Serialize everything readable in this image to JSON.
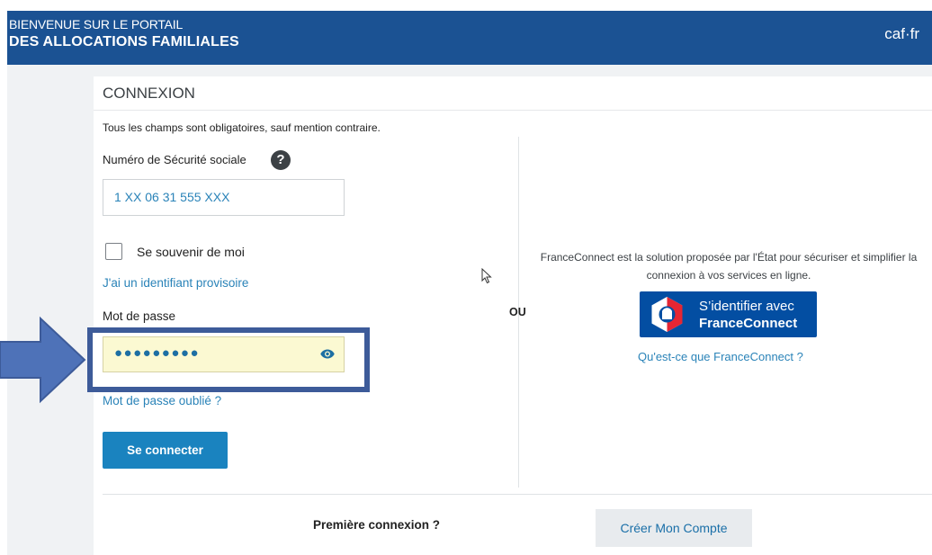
{
  "header": {
    "line1": "BIENVENUE SUR LE PORTAIL",
    "line2": "DES ALLOCATIONS FAMILIALES",
    "logo": "caf·fr"
  },
  "login": {
    "title": "CONNEXION",
    "required_note": "Tous les champs sont obligatoires, sauf mention contraire.",
    "nss_label": "Numéro de Sécurité sociale",
    "help_icon": "?",
    "nss_value": "1 XX 06 31 555 XXX",
    "remember_label": "Se souvenir de moi",
    "temp_id_link": "J'ai un identifiant provisoire",
    "password_label": "Mot de passe",
    "password_value": "●●●●●●●●●",
    "forgot_link": "Mot de passe oublié ?",
    "submit_label": "Se connecter"
  },
  "separator": {
    "ou": "OU"
  },
  "franceconnect": {
    "description": "FranceConnect est la solution proposée par l'État pour sécuriser et simplifier la connexion à vos services en ligne.",
    "button_line1": "S’identifier avec",
    "button_line2": "FranceConnect",
    "what_link": "Qu'est-ce que FranceConnect ?"
  },
  "footer": {
    "first_connection": "Première connexion ?",
    "create_account": "Créer Mon Compte"
  },
  "icons": {
    "help": "question-circle-icon",
    "eye": "eye-icon",
    "arrow": "right-arrow-annotation-icon",
    "cursor": "mouse-cursor-icon"
  },
  "colors": {
    "header_bg": "#1b5293",
    "link": "#2a83b8",
    "button": "#1a83bf",
    "franceconnect": "#034ea2",
    "highlight_border": "#3d5b99",
    "password_bg": "#fbf9d2"
  }
}
